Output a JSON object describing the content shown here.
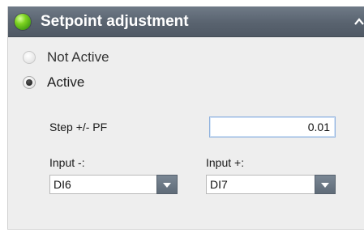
{
  "panel": {
    "title": "Setpoint adjustment",
    "status_color": "#7ed321",
    "header_color": "#5b6571"
  },
  "mode": {
    "options": [
      {
        "label": "Not Active",
        "selected": false
      },
      {
        "label": "Active",
        "selected": true
      }
    ]
  },
  "step": {
    "label": "Step +/- PF",
    "value": "0.01"
  },
  "input_minus": {
    "label": "Input -:",
    "value": "DI6"
  },
  "input_plus": {
    "label": "Input +:",
    "value": "DI7"
  },
  "icons": {
    "status": "status-led-icon",
    "collapse": "chevron-up-icon",
    "dropdown": "chevron-down-icon"
  }
}
